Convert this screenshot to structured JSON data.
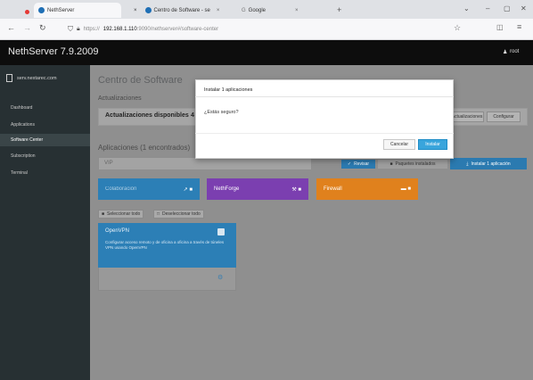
{
  "browser": {
    "tabs": [
      {
        "label": "NethServer",
        "close": "×"
      },
      {
        "label": "Centro de Software - se",
        "close": "×"
      },
      {
        "label": "Google",
        "close": "×"
      }
    ],
    "new_tab": "+",
    "url_prefix": "https://",
    "url_host": "192.168.1.110",
    "url_path": ":9090/nethserver#/software-center"
  },
  "app": {
    "brand": "NethServer 7.9.2009",
    "user_menu": "root",
    "sidebar": {
      "host": "serv.nextarec.com",
      "items": [
        {
          "label": "Dashboard",
          "active": false
        },
        {
          "label": "Applications",
          "active": false
        },
        {
          "label": "Software Center",
          "active": true
        },
        {
          "label": "Subscription",
          "active": false
        },
        {
          "label": "Terminal",
          "active": false
        }
      ]
    },
    "page_title": "Centro de Software",
    "updates_label": "Actualizaciones",
    "updates_text": "Actualizaciones disponibles",
    "updates_count": "4",
    "btn_updates": "Actualizaciones",
    "btn_configure": "Configurar",
    "apps_label": "Aplicaciones (1 encontrados)",
    "search_placeholder": "VIP",
    "btn_review": "Revisar",
    "btn_available": "Paquetes instalados",
    "btn_install_one": "Instalar 1 aplicación",
    "categories": [
      {
        "label": "Colaboración",
        "color": "#2c7fb6"
      },
      {
        "label": "NethForge",
        "color": "#7b3fb0"
      },
      {
        "label": "Firewall",
        "color": "#e0811d"
      }
    ],
    "select_all": "Seleccionar todo",
    "deselect_all": "Deseleccionar todo",
    "card": {
      "title": "OpenVPN",
      "description": "Configurar acceso remoto y de oficina a oficina a través de túneles VPN usando OpenVPN"
    }
  },
  "modal": {
    "title": "Instalar 1 aplicaciones",
    "body": "¿Estás seguro?",
    "cancel": "Cancelar",
    "install": "Instalar"
  }
}
